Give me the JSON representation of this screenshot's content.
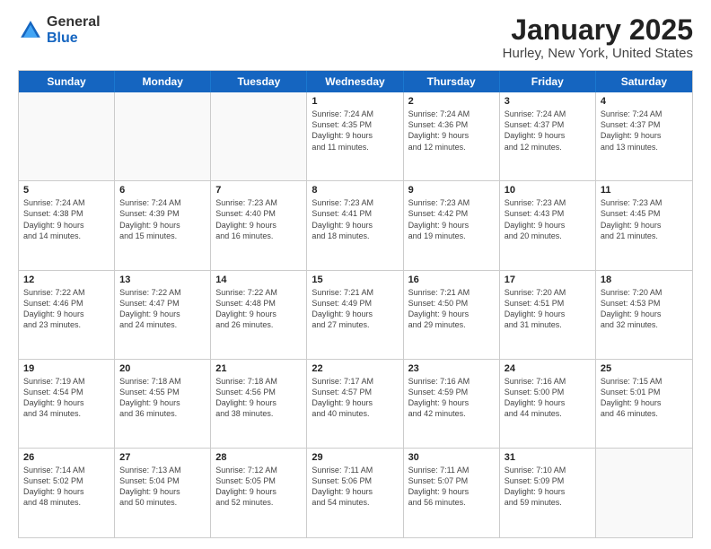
{
  "logo": {
    "general": "General",
    "blue": "Blue"
  },
  "title": "January 2025",
  "subtitle": "Hurley, New York, United States",
  "days": [
    "Sunday",
    "Monday",
    "Tuesday",
    "Wednesday",
    "Thursday",
    "Friday",
    "Saturday"
  ],
  "weeks": [
    [
      {
        "day": null,
        "info": null
      },
      {
        "day": null,
        "info": null
      },
      {
        "day": null,
        "info": null
      },
      {
        "day": "1",
        "info": "Sunrise: 7:24 AM\nSunset: 4:35 PM\nDaylight: 9 hours\nand 11 minutes."
      },
      {
        "day": "2",
        "info": "Sunrise: 7:24 AM\nSunset: 4:36 PM\nDaylight: 9 hours\nand 12 minutes."
      },
      {
        "day": "3",
        "info": "Sunrise: 7:24 AM\nSunset: 4:37 PM\nDaylight: 9 hours\nand 12 minutes."
      },
      {
        "day": "4",
        "info": "Sunrise: 7:24 AM\nSunset: 4:37 PM\nDaylight: 9 hours\nand 13 minutes."
      }
    ],
    [
      {
        "day": "5",
        "info": "Sunrise: 7:24 AM\nSunset: 4:38 PM\nDaylight: 9 hours\nand 14 minutes."
      },
      {
        "day": "6",
        "info": "Sunrise: 7:24 AM\nSunset: 4:39 PM\nDaylight: 9 hours\nand 15 minutes."
      },
      {
        "day": "7",
        "info": "Sunrise: 7:23 AM\nSunset: 4:40 PM\nDaylight: 9 hours\nand 16 minutes."
      },
      {
        "day": "8",
        "info": "Sunrise: 7:23 AM\nSunset: 4:41 PM\nDaylight: 9 hours\nand 18 minutes."
      },
      {
        "day": "9",
        "info": "Sunrise: 7:23 AM\nSunset: 4:42 PM\nDaylight: 9 hours\nand 19 minutes."
      },
      {
        "day": "10",
        "info": "Sunrise: 7:23 AM\nSunset: 4:43 PM\nDaylight: 9 hours\nand 20 minutes."
      },
      {
        "day": "11",
        "info": "Sunrise: 7:23 AM\nSunset: 4:45 PM\nDaylight: 9 hours\nand 21 minutes."
      }
    ],
    [
      {
        "day": "12",
        "info": "Sunrise: 7:22 AM\nSunset: 4:46 PM\nDaylight: 9 hours\nand 23 minutes."
      },
      {
        "day": "13",
        "info": "Sunrise: 7:22 AM\nSunset: 4:47 PM\nDaylight: 9 hours\nand 24 minutes."
      },
      {
        "day": "14",
        "info": "Sunrise: 7:22 AM\nSunset: 4:48 PM\nDaylight: 9 hours\nand 26 minutes."
      },
      {
        "day": "15",
        "info": "Sunrise: 7:21 AM\nSunset: 4:49 PM\nDaylight: 9 hours\nand 27 minutes."
      },
      {
        "day": "16",
        "info": "Sunrise: 7:21 AM\nSunset: 4:50 PM\nDaylight: 9 hours\nand 29 minutes."
      },
      {
        "day": "17",
        "info": "Sunrise: 7:20 AM\nSunset: 4:51 PM\nDaylight: 9 hours\nand 31 minutes."
      },
      {
        "day": "18",
        "info": "Sunrise: 7:20 AM\nSunset: 4:53 PM\nDaylight: 9 hours\nand 32 minutes."
      }
    ],
    [
      {
        "day": "19",
        "info": "Sunrise: 7:19 AM\nSunset: 4:54 PM\nDaylight: 9 hours\nand 34 minutes."
      },
      {
        "day": "20",
        "info": "Sunrise: 7:18 AM\nSunset: 4:55 PM\nDaylight: 9 hours\nand 36 minutes."
      },
      {
        "day": "21",
        "info": "Sunrise: 7:18 AM\nSunset: 4:56 PM\nDaylight: 9 hours\nand 38 minutes."
      },
      {
        "day": "22",
        "info": "Sunrise: 7:17 AM\nSunset: 4:57 PM\nDaylight: 9 hours\nand 40 minutes."
      },
      {
        "day": "23",
        "info": "Sunrise: 7:16 AM\nSunset: 4:59 PM\nDaylight: 9 hours\nand 42 minutes."
      },
      {
        "day": "24",
        "info": "Sunrise: 7:16 AM\nSunset: 5:00 PM\nDaylight: 9 hours\nand 44 minutes."
      },
      {
        "day": "25",
        "info": "Sunrise: 7:15 AM\nSunset: 5:01 PM\nDaylight: 9 hours\nand 46 minutes."
      }
    ],
    [
      {
        "day": "26",
        "info": "Sunrise: 7:14 AM\nSunset: 5:02 PM\nDaylight: 9 hours\nand 48 minutes."
      },
      {
        "day": "27",
        "info": "Sunrise: 7:13 AM\nSunset: 5:04 PM\nDaylight: 9 hours\nand 50 minutes."
      },
      {
        "day": "28",
        "info": "Sunrise: 7:12 AM\nSunset: 5:05 PM\nDaylight: 9 hours\nand 52 minutes."
      },
      {
        "day": "29",
        "info": "Sunrise: 7:11 AM\nSunset: 5:06 PM\nDaylight: 9 hours\nand 54 minutes."
      },
      {
        "day": "30",
        "info": "Sunrise: 7:11 AM\nSunset: 5:07 PM\nDaylight: 9 hours\nand 56 minutes."
      },
      {
        "day": "31",
        "info": "Sunrise: 7:10 AM\nSunset: 5:09 PM\nDaylight: 9 hours\nand 59 minutes."
      },
      {
        "day": null,
        "info": null
      }
    ]
  ]
}
